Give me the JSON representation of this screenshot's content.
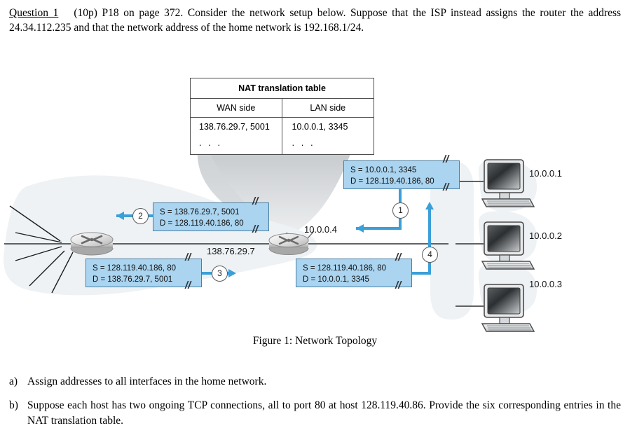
{
  "question": {
    "label": "Question 1",
    "points": "(10p)",
    "text": "P18 on page 372.  Consider the network setup below.  Suppose that the ISP instead assigns the router the address 24.34.112.235 and that the network address of the home network is 192.168.1/24."
  },
  "figure": {
    "caption": "Figure 1: Network Topology",
    "nat_table": {
      "title": "NAT translation table",
      "columns": [
        "WAN side",
        "LAN side"
      ],
      "rows": [
        [
          "138.76.29.7, 5001",
          "10.0.0.1, 3345"
        ],
        [
          ". . .",
          ". . ."
        ]
      ]
    },
    "packets": [
      {
        "id": "1",
        "step": "1",
        "source": "S = 10.0.0.1, 3345",
        "dest": "D = 128.119.40.186, 80"
      },
      {
        "id": "2",
        "step": "2",
        "source": "S = 138.76.29.7, 5001",
        "dest": "D = 128.119.40.186, 80"
      },
      {
        "id": "3",
        "step": "3",
        "source": "S = 128.119.40.186, 80",
        "dest": "D = 138.76.29.7, 5001"
      },
      {
        "id": "4",
        "step": "4",
        "source": "S = 128.119.40.186, 80",
        "dest": "D = 10.0.0.1, 3345"
      }
    ],
    "interface_labels": {
      "wan_router": "138.76.29.7",
      "lan_router": "10.0.0.4"
    },
    "hosts": [
      {
        "address": "10.0.0.1"
      },
      {
        "address": "10.0.0.2"
      },
      {
        "address": "10.0.0.3"
      }
    ],
    "tear_mark": "//",
    "colors": {
      "packet_fill": "#aad4ef",
      "packet_border": "#4b7fa3",
      "arrow": "#3b9fd8",
      "cloud": "#eef2f4",
      "line": "#555555"
    }
  },
  "answers": [
    {
      "marker": "a)",
      "text": "Assign addresses to all interfaces in the home network."
    },
    {
      "marker": "b)",
      "text": "Suppose each host has two ongoing TCP connections, all to port 80 at host 128.119.40.86. Provide the six corresponding entries in the NAT translation table."
    }
  ]
}
